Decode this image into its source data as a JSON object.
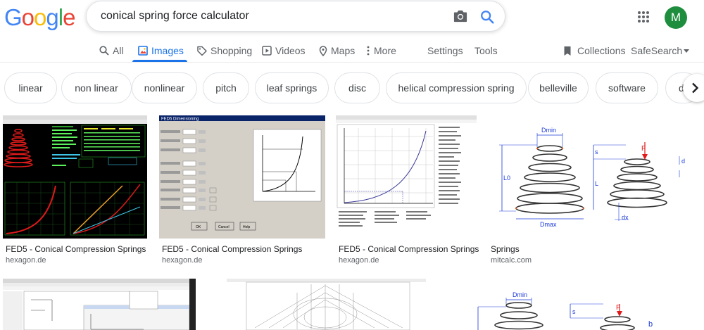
{
  "header": {
    "logo_letters": [
      {
        "ch": "G",
        "color": "#4285f4"
      },
      {
        "ch": "o",
        "color": "#ea4335"
      },
      {
        "ch": "o",
        "color": "#fbbc05"
      },
      {
        "ch": "g",
        "color": "#4285f4"
      },
      {
        "ch": "l",
        "color": "#34a853"
      },
      {
        "ch": "e",
        "color": "#ea4335"
      }
    ],
    "search_query": "conical spring force calculator",
    "avatar_letter": "M",
    "avatar_color": "#1e8e3e"
  },
  "tabs": {
    "all": "All",
    "images": "Images",
    "shopping": "Shopping",
    "videos": "Videos",
    "maps": "Maps",
    "more": "More",
    "settings": "Settings",
    "tools": "Tools",
    "collections": "Collections",
    "safesearch": "SafeSearch",
    "active_color": "#1a73e8"
  },
  "chips": [
    "linear",
    "non linear",
    "nonlinear",
    "pitch",
    "leaf springs",
    "disc",
    "helical compression spring",
    "belleville",
    "software",
    "d"
  ],
  "results": [
    {
      "title": "FED5 - Conical Compression Springs",
      "site": "hexagon.de"
    },
    {
      "title": "FED5 - Conical Compression Springs",
      "site": "hexagon.de"
    },
    {
      "title": "FED5 - Conical Compression Springs",
      "site": "hexagon.de"
    },
    {
      "title": "Springs",
      "site": "mitcalc.com"
    }
  ],
  "thumb_text": {
    "fed5_window_title": "FED5 Dimensioning",
    "ok": "OK",
    "cancel": "Cancel",
    "help": "Help",
    "dmin": "Dmin",
    "dmax": "Dmax",
    "l0": "L0",
    "l": "L",
    "s": "s",
    "f": "F",
    "d": "d",
    "dx": "dx",
    "b": "b"
  }
}
